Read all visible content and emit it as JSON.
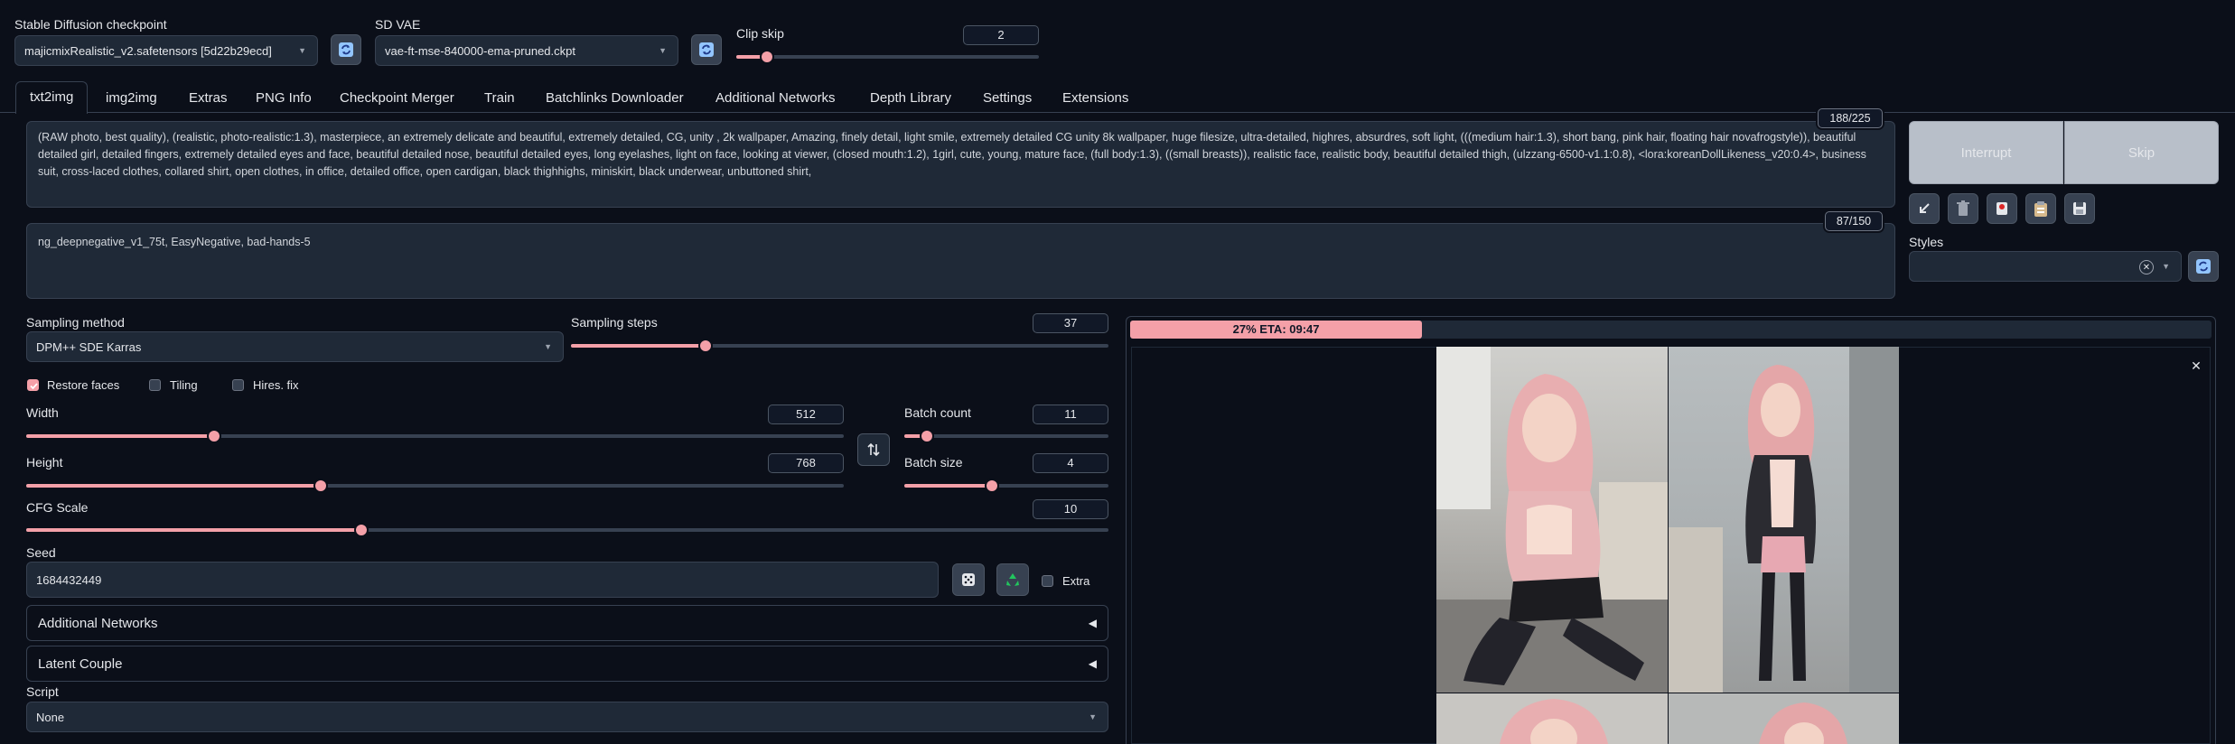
{
  "top": {
    "checkpoint": {
      "label": "Stable Diffusion checkpoint",
      "value": "majicmixRealistic_v2.safetensors [5d22b29ecd]"
    },
    "vae": {
      "label": "SD VAE",
      "value": "vae-ft-mse-840000-ema-pruned.ckpt"
    },
    "clip_skip": {
      "label": "Clip skip",
      "value": "2",
      "fraction": 0.1
    }
  },
  "tabs": [
    {
      "label": "txt2img",
      "active": true
    },
    {
      "label": "img2img"
    },
    {
      "label": "Extras"
    },
    {
      "label": "PNG Info"
    },
    {
      "label": "Checkpoint Merger"
    },
    {
      "label": "Train"
    },
    {
      "label": "Batchlinks Downloader"
    },
    {
      "label": "Additional Networks"
    },
    {
      "label": "Depth Library"
    },
    {
      "label": "Settings"
    },
    {
      "label": "Extensions"
    }
  ],
  "prompt": {
    "text": "(RAW photo, best quality), (realistic, photo-realistic:1.3), masterpiece, an extremely delicate and beautiful, extremely detailed, CG, unity , 2k wallpaper, Amazing, finely detail, light smile, extremely detailed CG unity 8k wallpaper, huge filesize, ultra-detailed, highres, absurdres, soft light, (((medium hair:1.3), short bang, pink hair, floating hair novafrogstyle)), beautiful detailed girl, detailed fingers, extremely detailed eyes and face, beautiful detailed nose, beautiful detailed eyes, long eyelashes, light on face, looking at viewer, (closed mouth:1.2), 1girl, cute, young, mature face, (full body:1.3), ((small breasts)), realistic face, realistic body, beautiful detailed thigh, (ulzzang-6500-v1.1:0.8), <lora:koreanDollLikeness_v20:0.4>, business suit, cross-laced clothes, collared shirt, open clothes, in office, detailed office, open cardigan, black thighhighs, miniskirt, black underwear, unbuttoned shirt,",
    "counter": "188/225"
  },
  "negative_prompt": {
    "text": "ng_deepnegative_v1_75t, EasyNegative, bad-hands-5",
    "counter": "87/150"
  },
  "actions": {
    "interrupt": "Interrupt",
    "skip": "Skip",
    "styles_label": "Styles"
  },
  "sampling": {
    "method_label": "Sampling method",
    "method_value": "DPM++ SDE Karras",
    "steps_label": "Sampling steps",
    "steps_value": "37",
    "steps_fraction": 0.25
  },
  "options": {
    "restore_faces": "Restore faces",
    "tiling": "Tiling",
    "hires_fix": "Hires. fix"
  },
  "size": {
    "width_label": "Width",
    "width_value": "512",
    "width_fraction": 0.23,
    "height_label": "Height",
    "height_value": "768",
    "height_fraction": 0.36,
    "batch_count_label": "Batch count",
    "batch_count_value": "11",
    "batch_count_fraction": 0.11,
    "batch_size_label": "Batch size",
    "batch_size_value": "4",
    "batch_size_fraction": 0.43
  },
  "cfg": {
    "label": "CFG Scale",
    "value": "10",
    "fraction": 0.31
  },
  "seed": {
    "label": "Seed",
    "value": "1684432449",
    "extra_label": "Extra"
  },
  "accordions": {
    "additional_networks": "Additional Networks",
    "latent_couple": "Latent Couple"
  },
  "script": {
    "label": "Script",
    "value": "None"
  },
  "progress": {
    "text": "27% ETA: 09:47",
    "fraction": 0.27
  },
  "colors": {
    "accent": "#f4a0a8",
    "background": "#0b0f19",
    "panel": "#1f2937"
  }
}
